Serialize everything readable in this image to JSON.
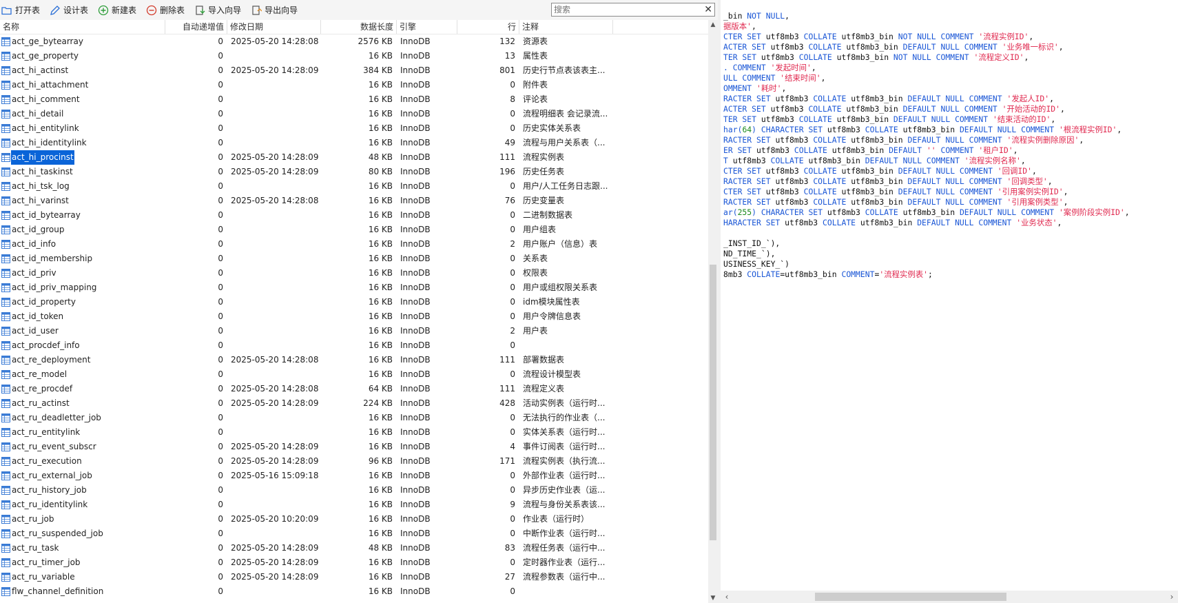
{
  "toolbar": {
    "open_table": "打开表",
    "design_table": "设计表",
    "new_table": "新建表",
    "delete_table": "删除表",
    "import_wizard": "导入向导",
    "export_wizard": "导出向导",
    "search_placeholder": "搜索"
  },
  "columns": {
    "name": "名称",
    "auto_inc": "自动递增值",
    "modified": "修改日期",
    "data_length": "数据长度",
    "engine": "引擎",
    "rows": "行",
    "comment": "注释"
  },
  "rows": [
    {
      "name": "act_ge_bytearray",
      "auto": "0",
      "date": "2025-05-20 14:28:08",
      "size": "2576 KB",
      "engine": "InnoDB",
      "rows": "132",
      "comment": "资源表"
    },
    {
      "name": "act_ge_property",
      "auto": "0",
      "date": "",
      "size": "16 KB",
      "engine": "InnoDB",
      "rows": "13",
      "comment": "属性表"
    },
    {
      "name": "act_hi_actinst",
      "auto": "0",
      "date": "2025-05-20 14:28:09",
      "size": "384 KB",
      "engine": "InnoDB",
      "rows": "801",
      "comment": "历史行节点表该表主..."
    },
    {
      "name": "act_hi_attachment",
      "auto": "0",
      "date": "",
      "size": "16 KB",
      "engine": "InnoDB",
      "rows": "0",
      "comment": "附件表"
    },
    {
      "name": "act_hi_comment",
      "auto": "0",
      "date": "",
      "size": "16 KB",
      "engine": "InnoDB",
      "rows": "8",
      "comment": "评论表"
    },
    {
      "name": "act_hi_detail",
      "auto": "0",
      "date": "",
      "size": "16 KB",
      "engine": "InnoDB",
      "rows": "0",
      "comment": "流程明细表 会记录流..."
    },
    {
      "name": "act_hi_entitylink",
      "auto": "0",
      "date": "",
      "size": "16 KB",
      "engine": "InnoDB",
      "rows": "0",
      "comment": "历史实体关系表"
    },
    {
      "name": "act_hi_identitylink",
      "auto": "0",
      "date": "",
      "size": "16 KB",
      "engine": "InnoDB",
      "rows": "49",
      "comment": "流程与用户关系表（..."
    },
    {
      "name": "act_hi_procinst",
      "auto": "0",
      "date": "2025-05-20 14:28:09",
      "size": "48 KB",
      "engine": "InnoDB",
      "rows": "111",
      "comment": "流程实例表",
      "selected": true
    },
    {
      "name": "act_hi_taskinst",
      "auto": "0",
      "date": "2025-05-20 14:28:09",
      "size": "80 KB",
      "engine": "InnoDB",
      "rows": "196",
      "comment": "历史任务表"
    },
    {
      "name": "act_hi_tsk_log",
      "auto": "0",
      "date": "",
      "size": "16 KB",
      "engine": "InnoDB",
      "rows": "0",
      "comment": "用户/人工任务日志跟..."
    },
    {
      "name": "act_hi_varinst",
      "auto": "0",
      "date": "2025-05-20 14:28:08",
      "size": "16 KB",
      "engine": "InnoDB",
      "rows": "76",
      "comment": "历史变量表"
    },
    {
      "name": "act_id_bytearray",
      "auto": "0",
      "date": "",
      "size": "16 KB",
      "engine": "InnoDB",
      "rows": "0",
      "comment": "二进制数据表"
    },
    {
      "name": "act_id_group",
      "auto": "0",
      "date": "",
      "size": "16 KB",
      "engine": "InnoDB",
      "rows": "0",
      "comment": "用户组表"
    },
    {
      "name": "act_id_info",
      "auto": "0",
      "date": "",
      "size": "16 KB",
      "engine": "InnoDB",
      "rows": "2",
      "comment": "用户账户（信息）表"
    },
    {
      "name": "act_id_membership",
      "auto": "0",
      "date": "",
      "size": "16 KB",
      "engine": "InnoDB",
      "rows": "0",
      "comment": "关系表"
    },
    {
      "name": "act_id_priv",
      "auto": "0",
      "date": "",
      "size": "16 KB",
      "engine": "InnoDB",
      "rows": "0",
      "comment": "权限表"
    },
    {
      "name": "act_id_priv_mapping",
      "auto": "0",
      "date": "",
      "size": "16 KB",
      "engine": "InnoDB",
      "rows": "0",
      "comment": "用户或组权限关系表"
    },
    {
      "name": "act_id_property",
      "auto": "0",
      "date": "",
      "size": "16 KB",
      "engine": "InnoDB",
      "rows": "0",
      "comment": "idm模块属性表"
    },
    {
      "name": "act_id_token",
      "auto": "0",
      "date": "",
      "size": "16 KB",
      "engine": "InnoDB",
      "rows": "0",
      "comment": "用户令牌信息表"
    },
    {
      "name": "act_id_user",
      "auto": "0",
      "date": "",
      "size": "16 KB",
      "engine": "InnoDB",
      "rows": "2",
      "comment": "用户表"
    },
    {
      "name": "act_procdef_info",
      "auto": "0",
      "date": "",
      "size": "16 KB",
      "engine": "InnoDB",
      "rows": "0",
      "comment": ""
    },
    {
      "name": "act_re_deployment",
      "auto": "0",
      "date": "2025-05-20 14:28:08",
      "size": "16 KB",
      "engine": "InnoDB",
      "rows": "111",
      "comment": "部署数据表"
    },
    {
      "name": "act_re_model",
      "auto": "0",
      "date": "",
      "size": "16 KB",
      "engine": "InnoDB",
      "rows": "0",
      "comment": "流程设计模型表"
    },
    {
      "name": "act_re_procdef",
      "auto": "0",
      "date": "2025-05-20 14:28:08",
      "size": "64 KB",
      "engine": "InnoDB",
      "rows": "111",
      "comment": "流程定义表"
    },
    {
      "name": "act_ru_actinst",
      "auto": "0",
      "date": "2025-05-20 14:28:09",
      "size": "224 KB",
      "engine": "InnoDB",
      "rows": "428",
      "comment": "活动实例表（运行时..."
    },
    {
      "name": "act_ru_deadletter_job",
      "auto": "0",
      "date": "",
      "size": "16 KB",
      "engine": "InnoDB",
      "rows": "0",
      "comment": "无法执行的作业表（..."
    },
    {
      "name": "act_ru_entitylink",
      "auto": "0",
      "date": "",
      "size": "16 KB",
      "engine": "InnoDB",
      "rows": "0",
      "comment": "实体关系表（运行时..."
    },
    {
      "name": "act_ru_event_subscr",
      "auto": "0",
      "date": "2025-05-20 14:28:09",
      "size": "16 KB",
      "engine": "InnoDB",
      "rows": "4",
      "comment": "事件订阅表（运行时..."
    },
    {
      "name": "act_ru_execution",
      "auto": "0",
      "date": "2025-05-20 14:28:09",
      "size": "96 KB",
      "engine": "InnoDB",
      "rows": "171",
      "comment": "流程实例表（执行流..."
    },
    {
      "name": "act_ru_external_job",
      "auto": "0",
      "date": "2025-05-16 15:09:18",
      "size": "16 KB",
      "engine": "InnoDB",
      "rows": "0",
      "comment": "外部作业表（运行时..."
    },
    {
      "name": "act_ru_history_job",
      "auto": "0",
      "date": "",
      "size": "16 KB",
      "engine": "InnoDB",
      "rows": "0",
      "comment": "异步历史作业表（运..."
    },
    {
      "name": "act_ru_identitylink",
      "auto": "0",
      "date": "",
      "size": "16 KB",
      "engine": "InnoDB",
      "rows": "9",
      "comment": "流程与身份关系表该..."
    },
    {
      "name": "act_ru_job",
      "auto": "0",
      "date": "2025-05-20 10:20:09",
      "size": "16 KB",
      "engine": "InnoDB",
      "rows": "0",
      "comment": "作业表（运行时）"
    },
    {
      "name": "act_ru_suspended_job",
      "auto": "0",
      "date": "",
      "size": "16 KB",
      "engine": "InnoDB",
      "rows": "0",
      "comment": "中断作业表（运行时..."
    },
    {
      "name": "act_ru_task",
      "auto": "0",
      "date": "2025-05-20 14:28:09",
      "size": "48 KB",
      "engine": "InnoDB",
      "rows": "83",
      "comment": "流程任务表（运行中..."
    },
    {
      "name": "act_ru_timer_job",
      "auto": "0",
      "date": "2025-05-20 14:28:09",
      "size": "16 KB",
      "engine": "InnoDB",
      "rows": "0",
      "comment": "定时器作业表（运行..."
    },
    {
      "name": "act_ru_variable",
      "auto": "0",
      "date": "2025-05-20 14:28:09",
      "size": "16 KB",
      "engine": "InnoDB",
      "rows": "27",
      "comment": "流程参数表（运行中..."
    },
    {
      "name": "flw_channel_definition",
      "auto": "0",
      "date": "",
      "size": "16 KB",
      "engine": "InnoDB",
      "rows": "0",
      "comment": ""
    }
  ],
  "ddl_lines": [
    [
      {
        "t": "_bin "
      },
      {
        "t": "NOT NULL",
        "c": "kw"
      },
      {
        "t": ","
      }
    ],
    [
      {
        "t": "据版本'",
        "c": "str"
      },
      {
        "t": ","
      }
    ],
    [
      {
        "t": "CTER SET ",
        "c": "kw"
      },
      {
        "t": "utf8mb3 "
      },
      {
        "t": "COLLATE ",
        "c": "kw"
      },
      {
        "t": "utf8mb3_bin "
      },
      {
        "t": "NOT NULL COMMENT ",
        "c": "kw"
      },
      {
        "t": "'流程实例ID'",
        "c": "str"
      },
      {
        "t": ","
      }
    ],
    [
      {
        "t": "ACTER SET ",
        "c": "kw"
      },
      {
        "t": "utf8mb3 "
      },
      {
        "t": "COLLATE ",
        "c": "kw"
      },
      {
        "t": "utf8mb3_bin "
      },
      {
        "t": "DEFAULT NULL COMMENT ",
        "c": "kw"
      },
      {
        "t": "'业务唯一标识'",
        "c": "str"
      },
      {
        "t": ","
      }
    ],
    [
      {
        "t": "TER SET ",
        "c": "kw"
      },
      {
        "t": "utf8mb3 "
      },
      {
        "t": "COLLATE ",
        "c": "kw"
      },
      {
        "t": "utf8mb3_bin "
      },
      {
        "t": "NOT NULL COMMENT ",
        "c": "kw"
      },
      {
        "t": "'流程定义ID'",
        "c": "str"
      },
      {
        "t": ","
      }
    ],
    [
      {
        "t": ". COMMENT ",
        "c": "kw"
      },
      {
        "t": "'发起时间'",
        "c": "str"
      },
      {
        "t": ","
      }
    ],
    [
      {
        "t": "ULL COMMENT ",
        "c": "kw"
      },
      {
        "t": "'结束时间'",
        "c": "str"
      },
      {
        "t": ","
      }
    ],
    [
      {
        "t": "OMMENT ",
        "c": "kw"
      },
      {
        "t": "'耗时'",
        "c": "str"
      },
      {
        "t": ","
      }
    ],
    [
      {
        "t": "RACTER SET ",
        "c": "kw"
      },
      {
        "t": "utf8mb3 "
      },
      {
        "t": "COLLATE ",
        "c": "kw"
      },
      {
        "t": "utf8mb3_bin "
      },
      {
        "t": "DEFAULT NULL COMMENT ",
        "c": "kw"
      },
      {
        "t": "'发起人ID'",
        "c": "str"
      },
      {
        "t": ","
      }
    ],
    [
      {
        "t": "ACTER SET ",
        "c": "kw"
      },
      {
        "t": "utf8mb3 "
      },
      {
        "t": "COLLATE ",
        "c": "kw"
      },
      {
        "t": "utf8mb3_bin "
      },
      {
        "t": "DEFAULT NULL COMMENT ",
        "c": "kw"
      },
      {
        "t": "'开始活动的ID'",
        "c": "str"
      },
      {
        "t": ","
      }
    ],
    [
      {
        "t": "TER SET ",
        "c": "kw"
      },
      {
        "t": "utf8mb3 "
      },
      {
        "t": "COLLATE ",
        "c": "kw"
      },
      {
        "t": "utf8mb3_bin "
      },
      {
        "t": "DEFAULT NULL COMMENT ",
        "c": "kw"
      },
      {
        "t": "'结束活动的ID'",
        "c": "str"
      },
      {
        "t": ","
      }
    ],
    [
      {
        "t": "har(",
        "c": "kw"
      },
      {
        "t": "64",
        "c": "num"
      },
      {
        "t": ") CHARACTER SET ",
        "c": "kw"
      },
      {
        "t": "utf8mb3 "
      },
      {
        "t": "COLLATE ",
        "c": "kw"
      },
      {
        "t": "utf8mb3_bin "
      },
      {
        "t": "DEFAULT NULL COMMENT ",
        "c": "kw"
      },
      {
        "t": "'根流程实例ID'",
        "c": "str"
      },
      {
        "t": ","
      }
    ],
    [
      {
        "t": "RACTER SET ",
        "c": "kw"
      },
      {
        "t": "utf8mb3 "
      },
      {
        "t": "COLLATE ",
        "c": "kw"
      },
      {
        "t": "utf8mb3_bin "
      },
      {
        "t": "DEFAULT NULL COMMENT ",
        "c": "kw"
      },
      {
        "t": "'流程实例删除原因'",
        "c": "str"
      },
      {
        "t": ","
      }
    ],
    [
      {
        "t": "ER SET ",
        "c": "kw"
      },
      {
        "t": "utf8mb3 "
      },
      {
        "t": "COLLATE ",
        "c": "kw"
      },
      {
        "t": "utf8mb3_bin "
      },
      {
        "t": "DEFAULT ",
        "c": "kw"
      },
      {
        "t": "'' ",
        "c": "str"
      },
      {
        "t": "COMMENT ",
        "c": "kw"
      },
      {
        "t": "'租户ID'",
        "c": "str"
      },
      {
        "t": ","
      }
    ],
    [
      {
        "t": "T ",
        "c": "kw"
      },
      {
        "t": "utf8mb3 "
      },
      {
        "t": "COLLATE ",
        "c": "kw"
      },
      {
        "t": "utf8mb3_bin "
      },
      {
        "t": "DEFAULT NULL COMMENT ",
        "c": "kw"
      },
      {
        "t": "'流程实例名称'",
        "c": "str"
      },
      {
        "t": ","
      }
    ],
    [
      {
        "t": "CTER SET ",
        "c": "kw"
      },
      {
        "t": "utf8mb3 "
      },
      {
        "t": "COLLATE ",
        "c": "kw"
      },
      {
        "t": "utf8mb3_bin "
      },
      {
        "t": "DEFAULT NULL COMMENT ",
        "c": "kw"
      },
      {
        "t": "'回调ID'",
        "c": "str"
      },
      {
        "t": ","
      }
    ],
    [
      {
        "t": "RACTER SET ",
        "c": "kw"
      },
      {
        "t": "utf8mb3 "
      },
      {
        "t": "COLLATE ",
        "c": "kw"
      },
      {
        "t": "utf8mb3_bin "
      },
      {
        "t": "DEFAULT NULL COMMENT ",
        "c": "kw"
      },
      {
        "t": "'回调类型'",
        "c": "str"
      },
      {
        "t": ","
      }
    ],
    [
      {
        "t": "CTER SET ",
        "c": "kw"
      },
      {
        "t": "utf8mb3 "
      },
      {
        "t": "COLLATE ",
        "c": "kw"
      },
      {
        "t": "utf8mb3_bin "
      },
      {
        "t": "DEFAULT NULL COMMENT ",
        "c": "kw"
      },
      {
        "t": "'引用案例实例ID'",
        "c": "str"
      },
      {
        "t": ","
      }
    ],
    [
      {
        "t": "RACTER SET ",
        "c": "kw"
      },
      {
        "t": "utf8mb3 "
      },
      {
        "t": "COLLATE ",
        "c": "kw"
      },
      {
        "t": "utf8mb3_bin "
      },
      {
        "t": "DEFAULT NULL COMMENT ",
        "c": "kw"
      },
      {
        "t": "'引用案例类型'",
        "c": "str"
      },
      {
        "t": ","
      }
    ],
    [
      {
        "t": "ar(",
        "c": "kw"
      },
      {
        "t": "255",
        "c": "num"
      },
      {
        "t": ") CHARACTER SET ",
        "c": "kw"
      },
      {
        "t": "utf8mb3 "
      },
      {
        "t": "COLLATE ",
        "c": "kw"
      },
      {
        "t": "utf8mb3_bin "
      },
      {
        "t": "DEFAULT NULL COMMENT ",
        "c": "kw"
      },
      {
        "t": "'案例阶段实例ID'",
        "c": "str"
      },
      {
        "t": ","
      }
    ],
    [
      {
        "t": "HARACTER SET ",
        "c": "kw"
      },
      {
        "t": "utf8mb3 "
      },
      {
        "t": "COLLATE ",
        "c": "kw"
      },
      {
        "t": "utf8mb3_bin "
      },
      {
        "t": "DEFAULT NULL COMMENT ",
        "c": "kw"
      },
      {
        "t": "'业务状态'",
        "c": "str"
      },
      {
        "t": ","
      }
    ],
    [
      {
        "t": ""
      }
    ],
    [
      {
        "t": "_INST_ID_`),"
      }
    ],
    [
      {
        "t": "ND_TIME_`),"
      }
    ],
    [
      {
        "t": "USINESS_KEY_`)"
      }
    ],
    [
      {
        "t": "8mb3 "
      },
      {
        "t": "COLLATE",
        "c": "kw"
      },
      {
        "t": "=utf8mb3_bin "
      },
      {
        "t": "COMMENT",
        "c": "kw"
      },
      {
        "t": "="
      },
      {
        "t": "'流程实例表'",
        "c": "str"
      },
      {
        "t": ";"
      }
    ]
  ],
  "colors": {
    "keyword": "#1a56d6",
    "string": "#e0294f",
    "number": "#1b8a1b",
    "selection": "#0a64d8"
  }
}
